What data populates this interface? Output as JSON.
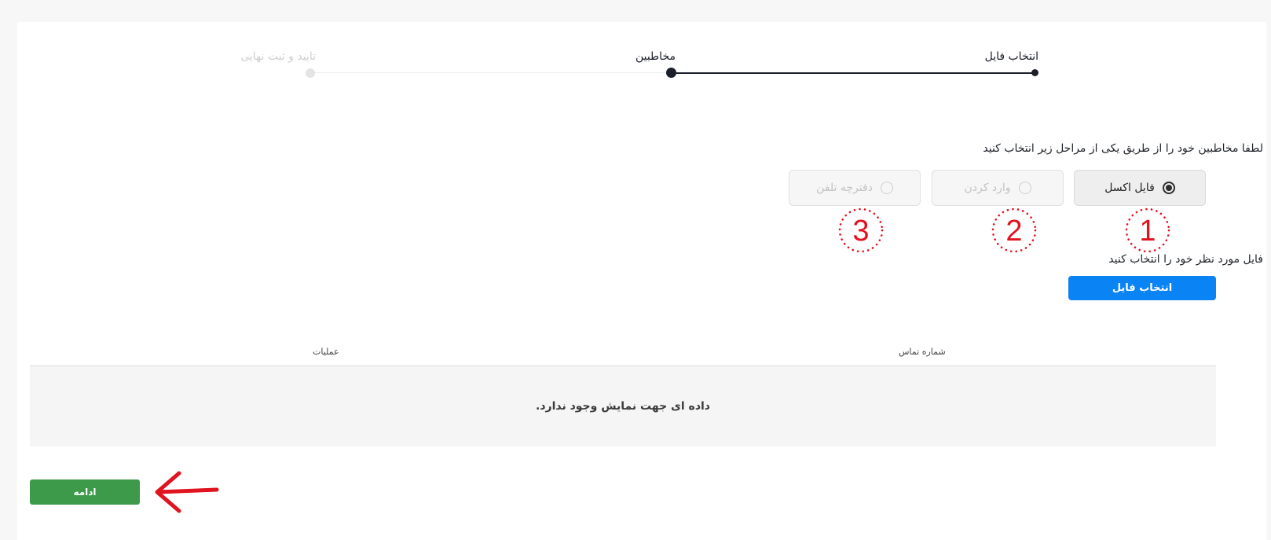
{
  "stepper": {
    "steps": [
      {
        "label": "انتخاب فایل",
        "state": "done"
      },
      {
        "label": "مخاطبین",
        "state": "current"
      },
      {
        "label": "تایید و ثبت نهایی",
        "state": "pending"
      }
    ],
    "active_color": "#1b1f2a",
    "pending_color": "#d9d9d9"
  },
  "prompt": "لطفا مخاطبین خود را از طریق یکی از مراحل زیر انتخاب کنید",
  "options": [
    {
      "label": "فایل اکسل",
      "selected": true,
      "enabled": true,
      "annotation": "1"
    },
    {
      "label": "وارد کردن",
      "selected": false,
      "enabled": false,
      "annotation": "2"
    },
    {
      "label": "دفترچه تلفن",
      "selected": false,
      "enabled": false,
      "annotation": "3"
    }
  ],
  "file_section": {
    "label": "فایل مورد نظر خود را انتخاب کنید",
    "button_label": "انتخاب فایل",
    "button_color": "#0a84f5"
  },
  "table": {
    "columns": [
      "شماره تماس",
      "عملیات"
    ],
    "empty_message": "داده ای جهت نمایش وجود ندارد."
  },
  "continue_button": {
    "label": "ادامه",
    "color": "#3d9a4a"
  },
  "annotation_color": "#e0131f",
  "icons": {
    "radio_selected": "radio-selected-icon",
    "radio_empty": "radio-empty-icon",
    "arrow": "arrow-left-icon"
  }
}
